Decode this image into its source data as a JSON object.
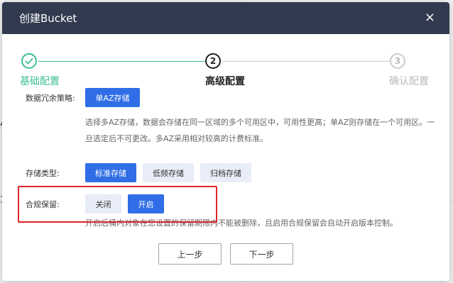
{
  "dialog": {
    "title": "创建Bucket",
    "close_icon": "×"
  },
  "steps": [
    {
      "number": "",
      "label": "基础配置",
      "state": "done"
    },
    {
      "number": "2",
      "label": "高级配置",
      "state": "active"
    },
    {
      "number": "3",
      "label": "确认配置",
      "state": "pending"
    }
  ],
  "redundancy": {
    "label": "数据冗余策略:",
    "options": [
      "单AZ存储"
    ],
    "desc_line1": "选择多AZ存储，数据会存储在同一区域的多个可用区中，可用性更高；单AZ则存储在一个可用区。一",
    "desc_line2": "旦选定后不可更改。多AZ采用相对较高的计费标准。"
  },
  "storage_type": {
    "label": "存储类型:",
    "options": [
      "标准存储",
      "低频存储",
      "归档存储"
    ]
  },
  "compliance": {
    "label": "合规保留:",
    "options": [
      "关闭",
      "开启"
    ],
    "desc": "开启后桶内对象在您设置的保留期限内不能被删除，且启用合规保留会自动开启版本控制。"
  },
  "footer": {
    "prev": "上一步",
    "next": "下一步"
  },
  "colors": {
    "header": "#313a4e",
    "accent": "#2f6ee6",
    "done": "#3cbf91",
    "highlight": "#e0242a"
  },
  "background": {
    "frag1": "4",
    "frag2": "1"
  }
}
